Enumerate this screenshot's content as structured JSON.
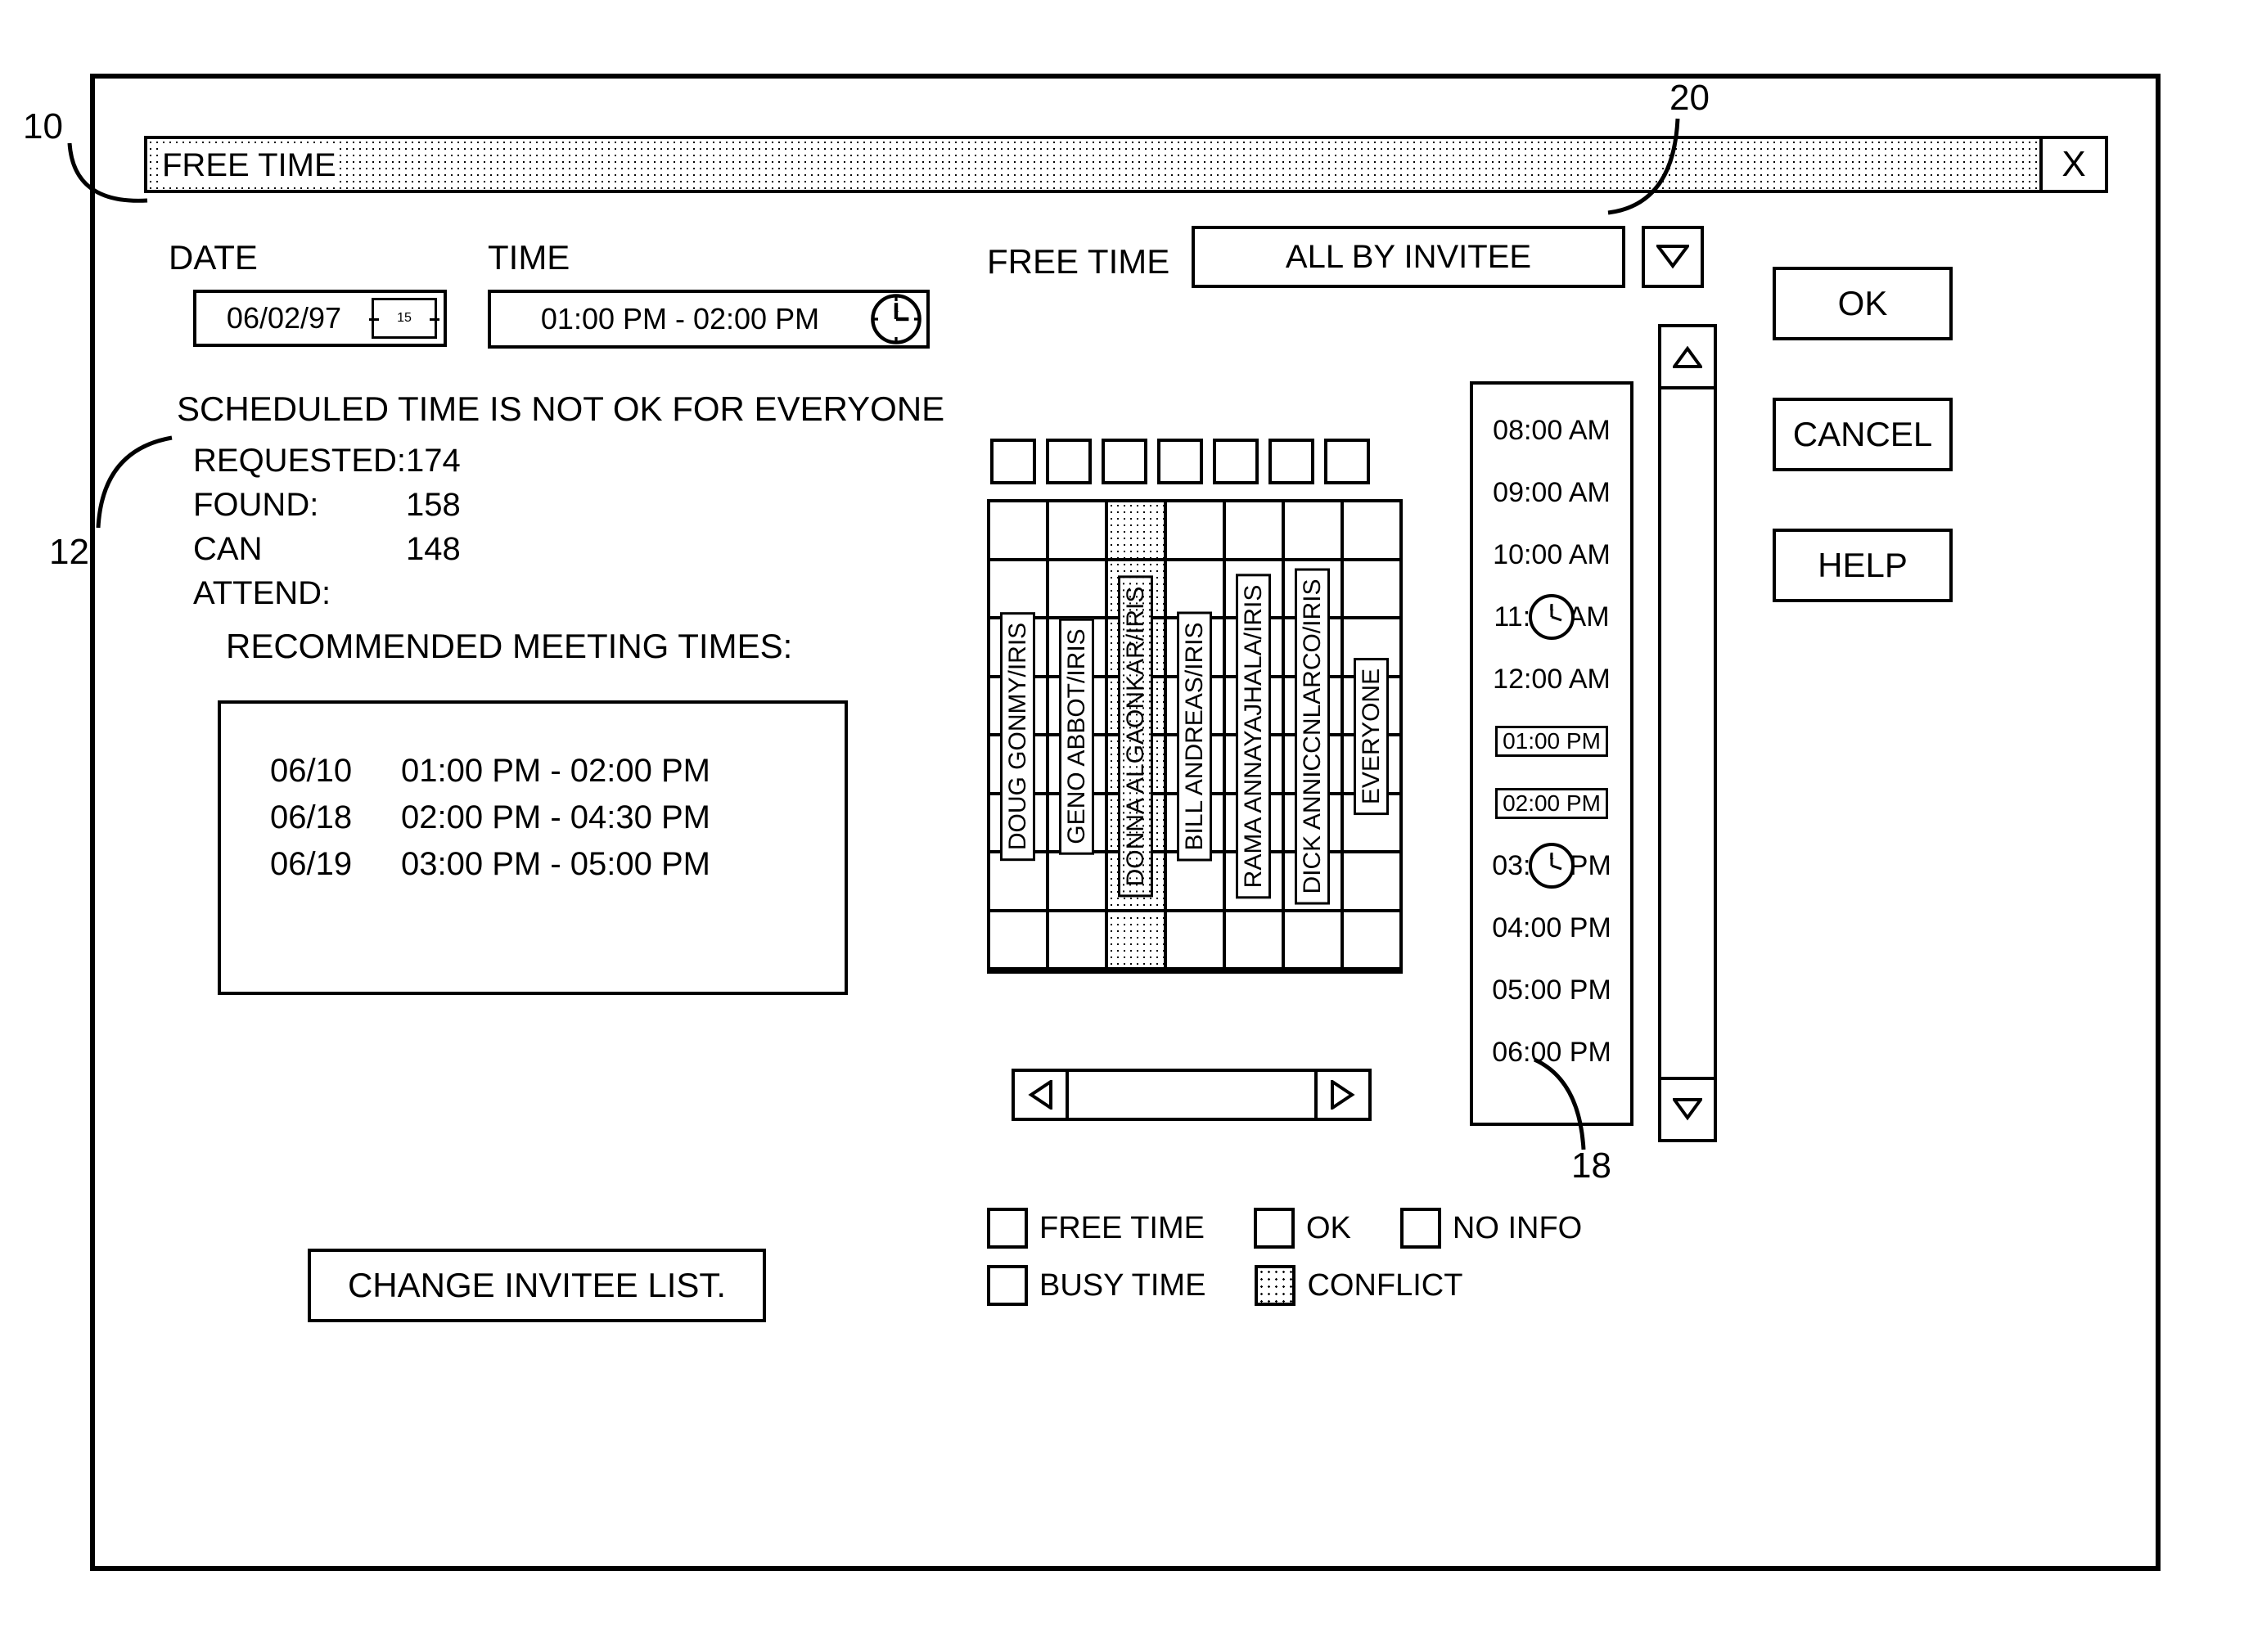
{
  "callouts": {
    "c10": "10",
    "c12": "12",
    "c18": "18",
    "c20": "20"
  },
  "titlebar": {
    "title": "FREE TIME",
    "close": "X"
  },
  "labels": {
    "date": "DATE",
    "time": "TIME",
    "free_time": "FREE TIME",
    "recommended": "RECOMMENDED MEETING TIMES:",
    "change_invitee": "CHANGE INVITEE LIST."
  },
  "date_field": {
    "value": "06/02/97",
    "icon_day": "15"
  },
  "time_field": {
    "value": "01:00 PM - 02:00 PM"
  },
  "status": "SCHEDULED TIME IS NOT OK FOR EVERYONE",
  "stats": {
    "requested_k": "REQUESTED:",
    "requested_v": "174",
    "found_k": "FOUND:",
    "found_v": "158",
    "attend_k": "CAN ATTEND:",
    "attend_v": "148"
  },
  "recommendations": [
    {
      "date": "06/10",
      "range": "01:00 PM - 02:00 PM"
    },
    {
      "date": "06/18",
      "range": "02:00 PM - 04:30 PM"
    },
    {
      "date": "06/19",
      "range": "03:00 PM - 05:00 PM"
    }
  ],
  "dropdown": {
    "value": "ALL BY INVITEE"
  },
  "buttons": {
    "ok": "OK",
    "cancel": "CANCEL",
    "help": "HELP"
  },
  "invitees": [
    {
      "name": "DOUG GONMY/IRIS",
      "conflict": false
    },
    {
      "name": "GENO ABBOT/IRIS",
      "conflict": false
    },
    {
      "name": "DONNA ALGAONKAR/IRIS",
      "conflict": true
    },
    {
      "name": "BILL ANDREAS/IRIS",
      "conflict": false
    },
    {
      "name": "RAMA ANNAYAJHALA/IRIS",
      "conflict": false
    },
    {
      "name": "DICK ANNICCNLARCO/IRIS",
      "conflict": false
    },
    {
      "name": "EVERYONE",
      "conflict": false
    }
  ],
  "times": [
    {
      "label": "08:00 AM"
    },
    {
      "label": "09:00 AM"
    },
    {
      "label": "10:00 AM"
    },
    {
      "label": "11:00 AM",
      "clock": true
    },
    {
      "label": "12:00 AM"
    },
    {
      "label": "01:00 PM",
      "boxed": true
    },
    {
      "label": "02:00 PM",
      "boxed": true
    },
    {
      "label": "03:00 PM",
      "clock": true
    },
    {
      "label": "04:00 PM"
    },
    {
      "label": "05:00 PM"
    },
    {
      "label": "06:00 PM"
    }
  ],
  "legend": {
    "free": "FREE TIME",
    "ok": "OK",
    "noinfo": "NO INFO",
    "busy": "BUSY TIME",
    "conflict": "CONFLICT"
  }
}
